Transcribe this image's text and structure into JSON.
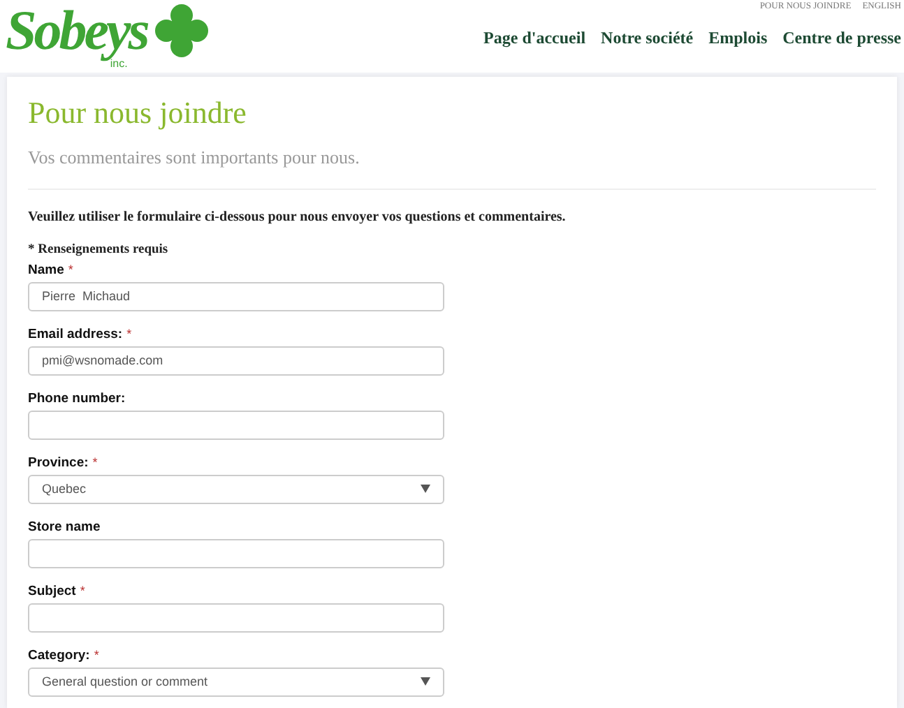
{
  "logo": {
    "wordmark": "Sobeys",
    "suffix": "inc."
  },
  "utility_links": [
    "POUR NOUS JOINDRE",
    "ENGLISH"
  ],
  "nav": [
    "Page d'accueil",
    "Notre société",
    "Emplois",
    "Centre de presse"
  ],
  "page": {
    "title": "Pour nous joindre",
    "subtitle": "Vos commentaires sont importants pour nous.",
    "intro": "Veuillez utiliser le formulaire ci-dessous pour nous envoyer vos questions et commentaires.",
    "required_note": "* Renseignements requis",
    "required_mark": "*"
  },
  "fields": [
    {
      "label": "Name",
      "kind": "text",
      "required": true,
      "value": "Pierre  Michaud"
    },
    {
      "label": "Email address:",
      "kind": "text",
      "required": true,
      "value": "pmi@wsnomade.com"
    },
    {
      "label": "Phone number:",
      "kind": "text",
      "required": false
    },
    {
      "label": "Province:",
      "kind": "select",
      "required": true,
      "value": "Quebec"
    },
    {
      "label": "Store name",
      "kind": "text",
      "required": false
    },
    {
      "label": "Subject",
      "kind": "text",
      "required": true
    },
    {
      "label": "Category:",
      "kind": "select",
      "required": true,
      "value": "General question or comment"
    }
  ]
}
